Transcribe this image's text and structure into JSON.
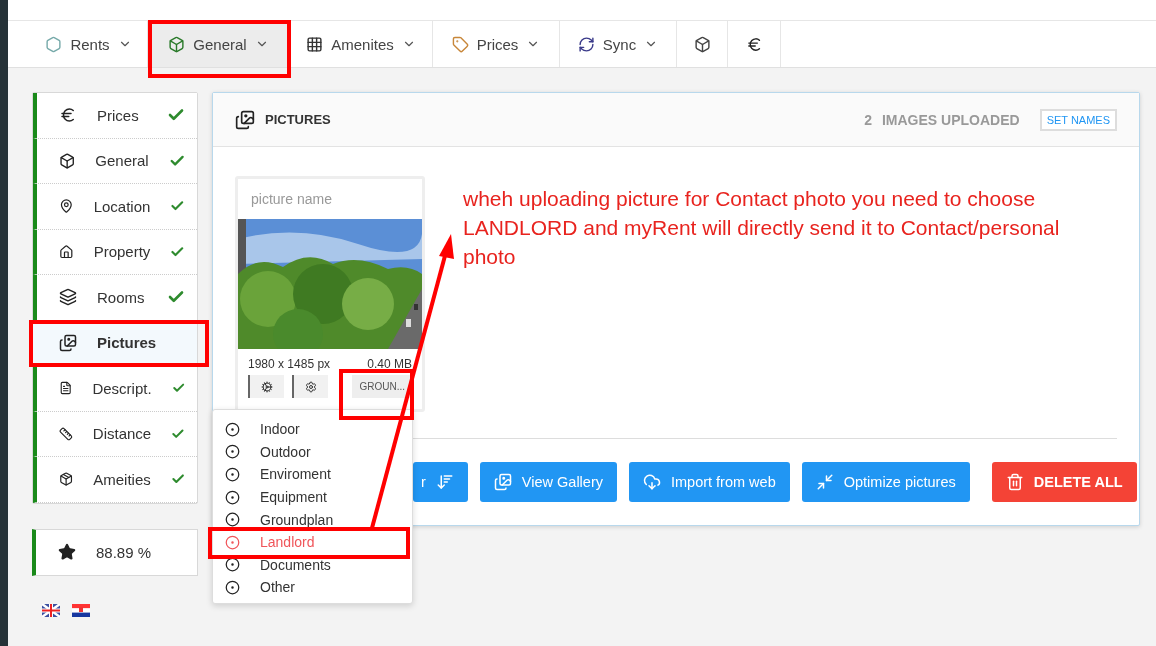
{
  "tabs": [
    {
      "label": "Rents",
      "kind": "menu",
      "selected": false
    },
    {
      "label": "General",
      "kind": "menu",
      "selected": true
    },
    {
      "label": "Amenites",
      "kind": "menu",
      "selected": false
    },
    {
      "label": "Prices",
      "kind": "menu",
      "selected": false
    },
    {
      "label": "Sync",
      "kind": "menu",
      "selected": false
    },
    {
      "kind": "icon",
      "selected": false
    },
    {
      "kind": "icon",
      "selected": false
    }
  ],
  "sidebar": {
    "items": [
      {
        "label": "Prices",
        "done": true,
        "selected": false
      },
      {
        "label": "General",
        "done": true,
        "selected": false
      },
      {
        "label": "Location",
        "done": true,
        "selected": false
      },
      {
        "label": "Property",
        "done": true,
        "selected": false
      },
      {
        "label": "Rooms",
        "done": true,
        "selected": false
      },
      {
        "label": "Pictures",
        "done": false,
        "selected": true
      },
      {
        "label": "Descript.",
        "done": true,
        "selected": false
      },
      {
        "label": "Distance",
        "done": true,
        "selected": false
      },
      {
        "label": "Ameities",
        "done": true,
        "selected": false
      }
    ],
    "score": "88.89 %"
  },
  "panel": {
    "title": "PICTURES",
    "count": "2",
    "count_label": "IMAGES UPLOADED",
    "set_names": "SET NAMES",
    "picture": {
      "placeholder": "picture name",
      "size": "1980 x 1485 px",
      "filesize": "0.40 MB",
      "category": "GROUN..."
    },
    "buttons": [
      {
        "label": "r",
        "kind": "primary"
      },
      {
        "label": "View Gallery",
        "kind": "primary"
      },
      {
        "label": "Import from web",
        "kind": "primary"
      },
      {
        "label": "Optimize pictures",
        "kind": "primary"
      },
      {
        "label": "DELETE ALL",
        "kind": "danger"
      }
    ]
  },
  "category_menu": [
    {
      "label": "Indoor",
      "selected": false
    },
    {
      "label": "Outdoor",
      "selected": false
    },
    {
      "label": "Enviroment",
      "selected": false
    },
    {
      "label": "Equipment",
      "selected": false
    },
    {
      "label": "Groundplan",
      "selected": false
    },
    {
      "label": "Landlord",
      "selected": true
    },
    {
      "label": "Documents",
      "selected": false
    },
    {
      "label": "Other",
      "selected": false
    }
  ],
  "annotation": "wheh uploading picture for Contact photo you need to choose LANDLORD and myRent will directly send it to Contact/personal photo"
}
